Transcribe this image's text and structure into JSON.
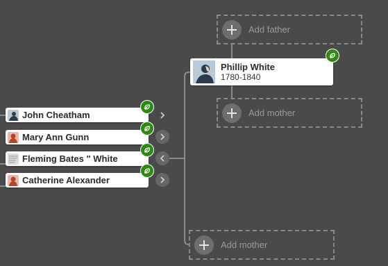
{
  "focus_person": {
    "name": "Phillip White",
    "dates": "1780-1840"
  },
  "add_slots": {
    "father": "Add father",
    "mother_top": "Add mother",
    "mother_bottom": "Add mother"
  },
  "children": [
    {
      "name": "John Cheatham",
      "photo": "male-avatar"
    },
    {
      "name": "Mary Ann Gunn",
      "photo": "female-avatar"
    },
    {
      "name": "Fleming Bates \" White",
      "photo": "document-thumbnail"
    },
    {
      "name": "Catherine Alexander",
      "photo": "female-avatar"
    }
  ],
  "colors": {
    "background": "#4a4a4a",
    "hint_green": "#2f8a14",
    "connector": "#8c8c8c",
    "card": "#ffffff"
  },
  "icons": {
    "hint": "leaf-icon",
    "expand": "chevron-right-icon",
    "collapse": "chevron-left-icon",
    "add": "plus-icon"
  }
}
